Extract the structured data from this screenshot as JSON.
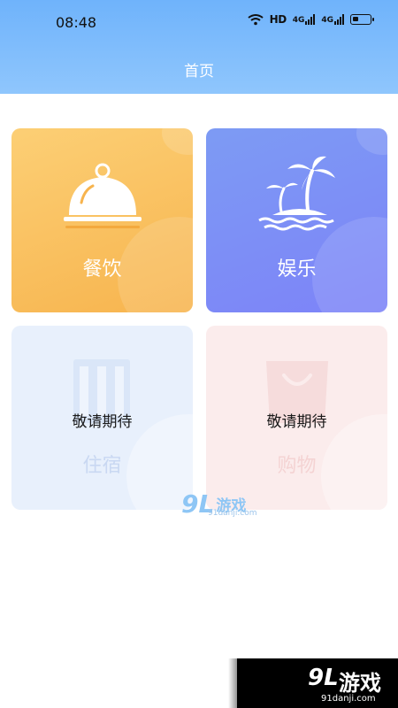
{
  "status_bar": {
    "time": "08:48",
    "hd_label": "HD",
    "signal_1": "4G",
    "signal_2": "4G"
  },
  "header": {
    "title": "首页",
    "color_top": "#6fb3fb",
    "color_bottom": "#8fc6fd"
  },
  "cards": [
    {
      "label": "餐饮",
      "icon": "dish-cloche-icon",
      "color": "#f7b44e",
      "status": ""
    },
    {
      "label": "娱乐",
      "icon": "palm-island-icon",
      "color": "#7d83f8",
      "status": ""
    },
    {
      "label": "住宿",
      "icon": "building-icon",
      "color": "#e8f0fc",
      "status": "敬请期待"
    },
    {
      "label": "购物",
      "icon": "shopping-bag-icon",
      "color": "#fbecec",
      "status": "敬请期待"
    }
  ],
  "watermark": {
    "logo_num": "9L",
    "logo_text": "游戏",
    "url": "91danji.com"
  },
  "brand_badge": {
    "logo_num": "9L",
    "logo_text": "游戏",
    "url": "91danji.com"
  }
}
